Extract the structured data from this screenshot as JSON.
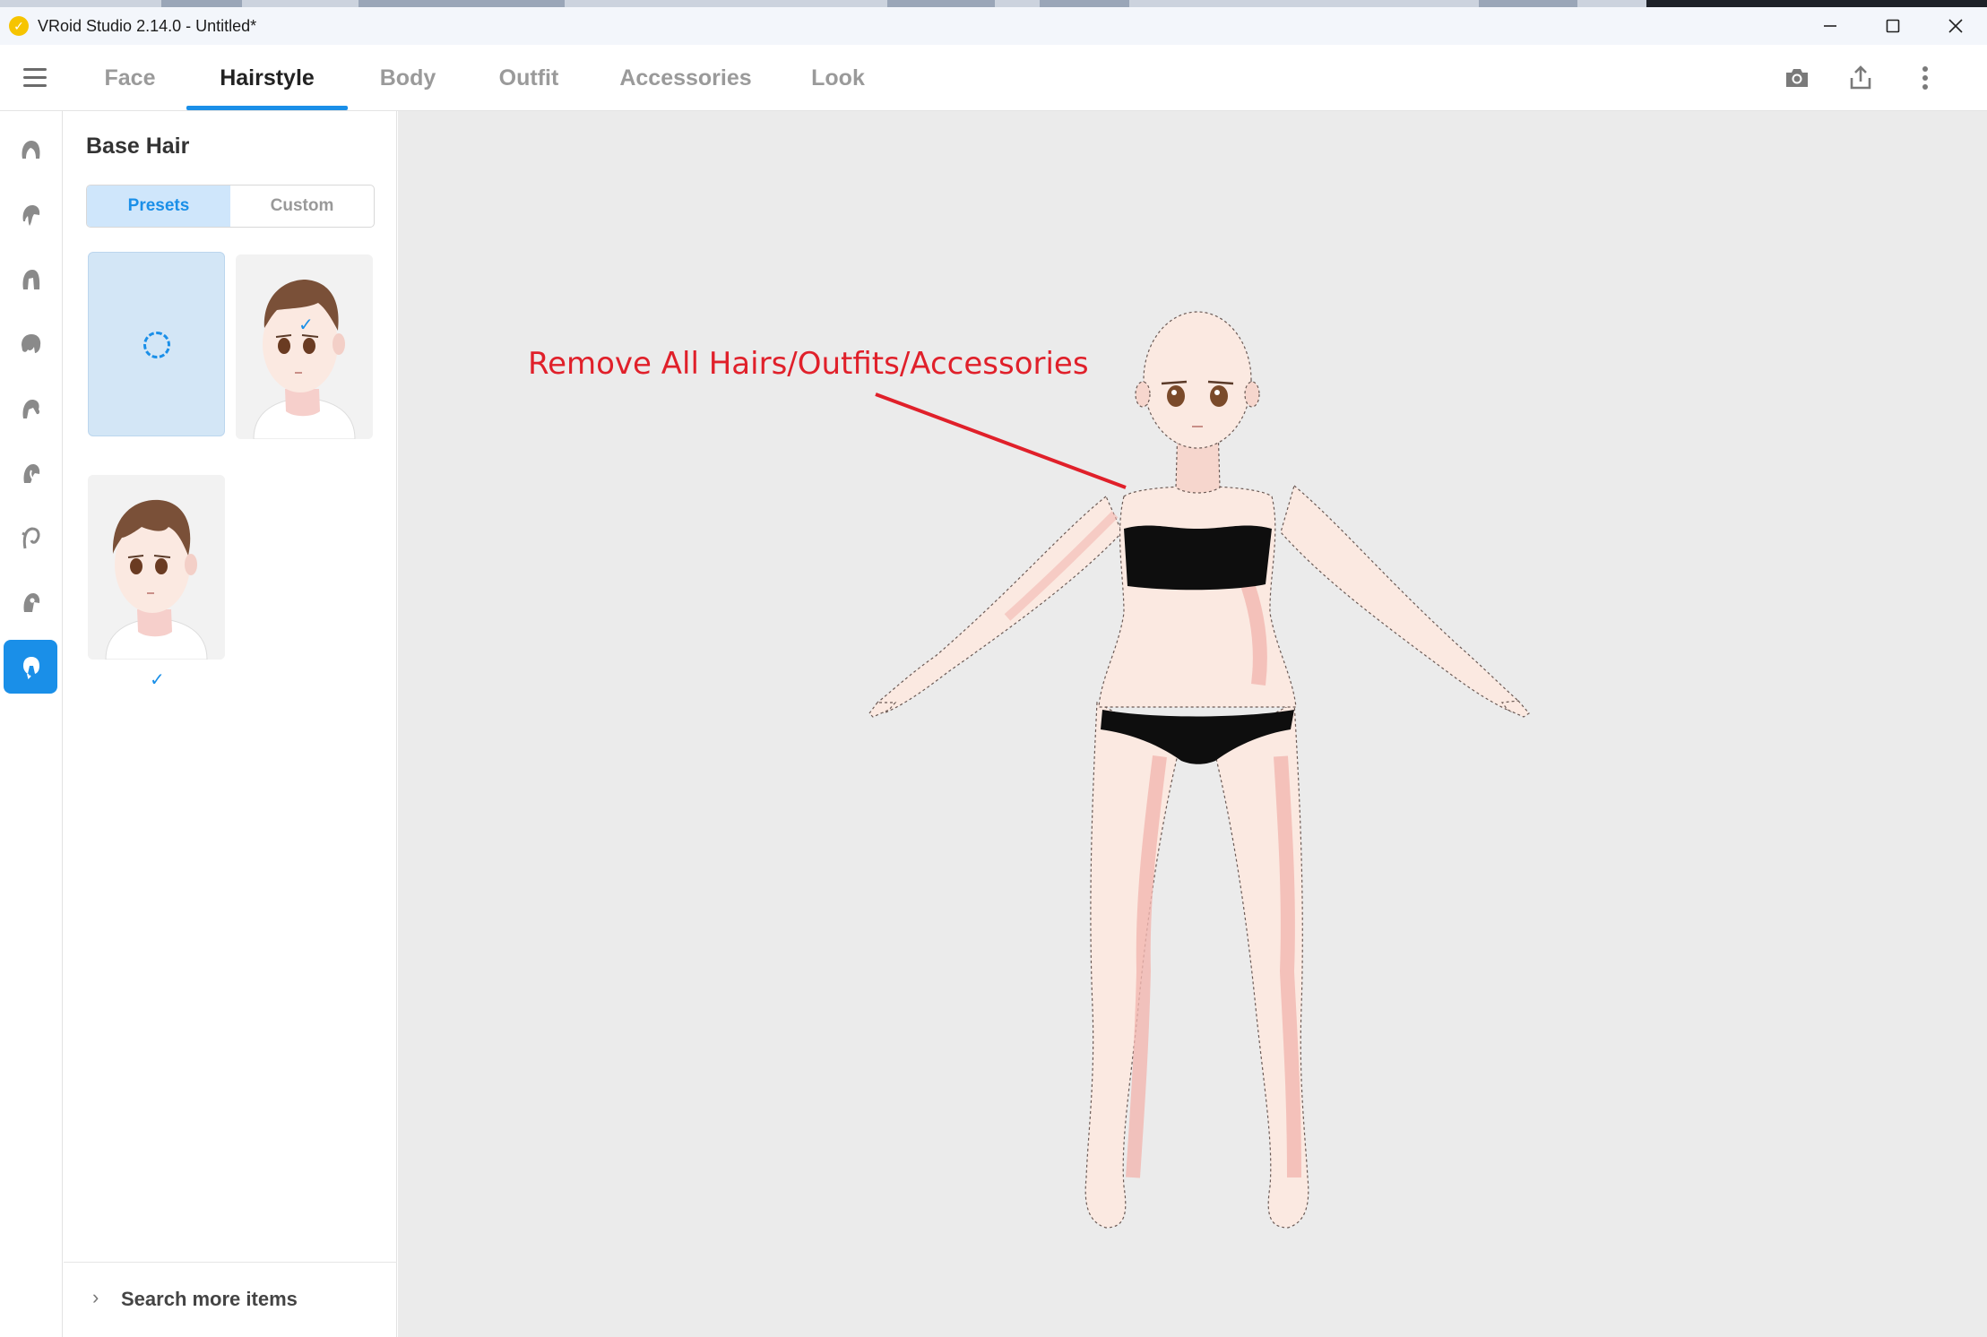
{
  "window": {
    "title": "VRoid Studio 2.14.0 - Untitled*",
    "logo": "vroid-logo",
    "controls": [
      "minimize-icon",
      "maximize-icon",
      "close-icon"
    ]
  },
  "nav": {
    "tabs": [
      {
        "label": "Face",
        "active": false
      },
      {
        "label": "Hairstyle",
        "active": true
      },
      {
        "label": "Body",
        "active": false
      },
      {
        "label": "Outfit",
        "active": false
      },
      {
        "label": "Accessories",
        "active": false
      },
      {
        "label": "Look",
        "active": false
      }
    ],
    "right_icons": [
      "camera-icon",
      "export-icon",
      "more-vertical-icon"
    ]
  },
  "rail": {
    "items": [
      "hair-icon-1",
      "hair-icon-2",
      "hair-icon-3",
      "hair-icon-4",
      "hair-icon-5",
      "hair-icon-6",
      "hair-icon-7",
      "hair-icon-8",
      "base-hair-icon"
    ],
    "active_index": 8
  },
  "panel": {
    "title": "Base Hair",
    "segments": {
      "presets": "Presets",
      "custom": "Custom",
      "active": "presets"
    },
    "check": "✓",
    "footer": {
      "label": "Search more items",
      "chevron": "›"
    }
  },
  "viewport": {
    "annotation": "Remove All Hairs/Outfits/Accessories"
  },
  "colors": {
    "accent": "#1a8fe8",
    "annotation": "#e0202a",
    "viewport_bg": "#ebebeb",
    "skin": "#fbe9e1",
    "skin_shadow": "#f3b7b0",
    "hair": "#7a5038"
  }
}
